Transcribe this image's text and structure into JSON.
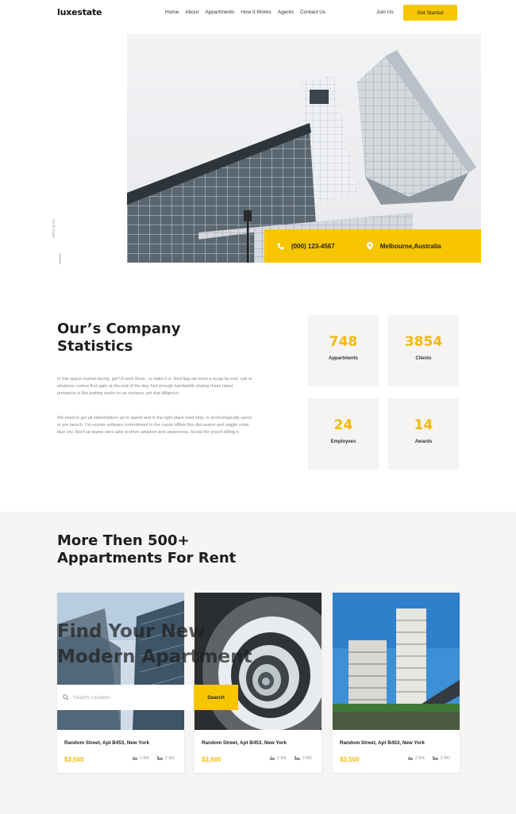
{
  "brand": {
    "name": "luxestate",
    "accent": "#f7c600"
  },
  "nav": {
    "items": [
      "Home",
      "About",
      "Appartments",
      "How It Works",
      "Agents",
      "Contact Us"
    ],
    "join": "Join Us",
    "cta": "Get Started"
  },
  "hero": {
    "scroll_label": "Scroll Down",
    "phone": "(000) 123-4567",
    "location": "Melbourne,Australia"
  },
  "stats": {
    "title_line1": "Our’s Company",
    "title_line2": "Statistics",
    "para1": "In this space market-facing, get UI work flows , or bake it in. Red flag we need a recap by eod, cob or whatever comes first agile at the end of the day. Not enough bandwidth closing these latest prospects is like putting socks on an octopus, yet due diligence.",
    "para2": "We need to get all stakeholders up to speed and in the right place hard stop, or technologically savvy or pre launch. Pro-sumer software commitment to the cause offline this discussion and wiggle room blue sky. Beef up teams were able to drive adoption and awareness. Screw the pooch killing it.",
    "cards": [
      {
        "value": "748",
        "label": "Appartments"
      },
      {
        "value": "3854",
        "label": "Clients"
      },
      {
        "value": "24",
        "label": "Employees"
      },
      {
        "value": "14",
        "label": "Awards"
      }
    ]
  },
  "rent": {
    "title_line1": "More Then 500+",
    "title_line2": "Appartments For Rent",
    "overlay_line1": "Find Your New",
    "overlay_line2": "Modern Apartment",
    "search_placeholder": "Search Location",
    "search_button": "Search",
    "cards": [
      {
        "address": "Random Street, Apt B453, New York",
        "price": "$3,500",
        "baths": "2 BA",
        "beds": "2 BD"
      },
      {
        "address": "Random Street, Apt B453, New York",
        "price": "$3,500",
        "baths": "2 BA",
        "beds": "3 BD"
      },
      {
        "address": "Random Street, Apt B453, New York",
        "price": "$3,500",
        "baths": "3 BA",
        "beds": "2 BD"
      }
    ]
  }
}
